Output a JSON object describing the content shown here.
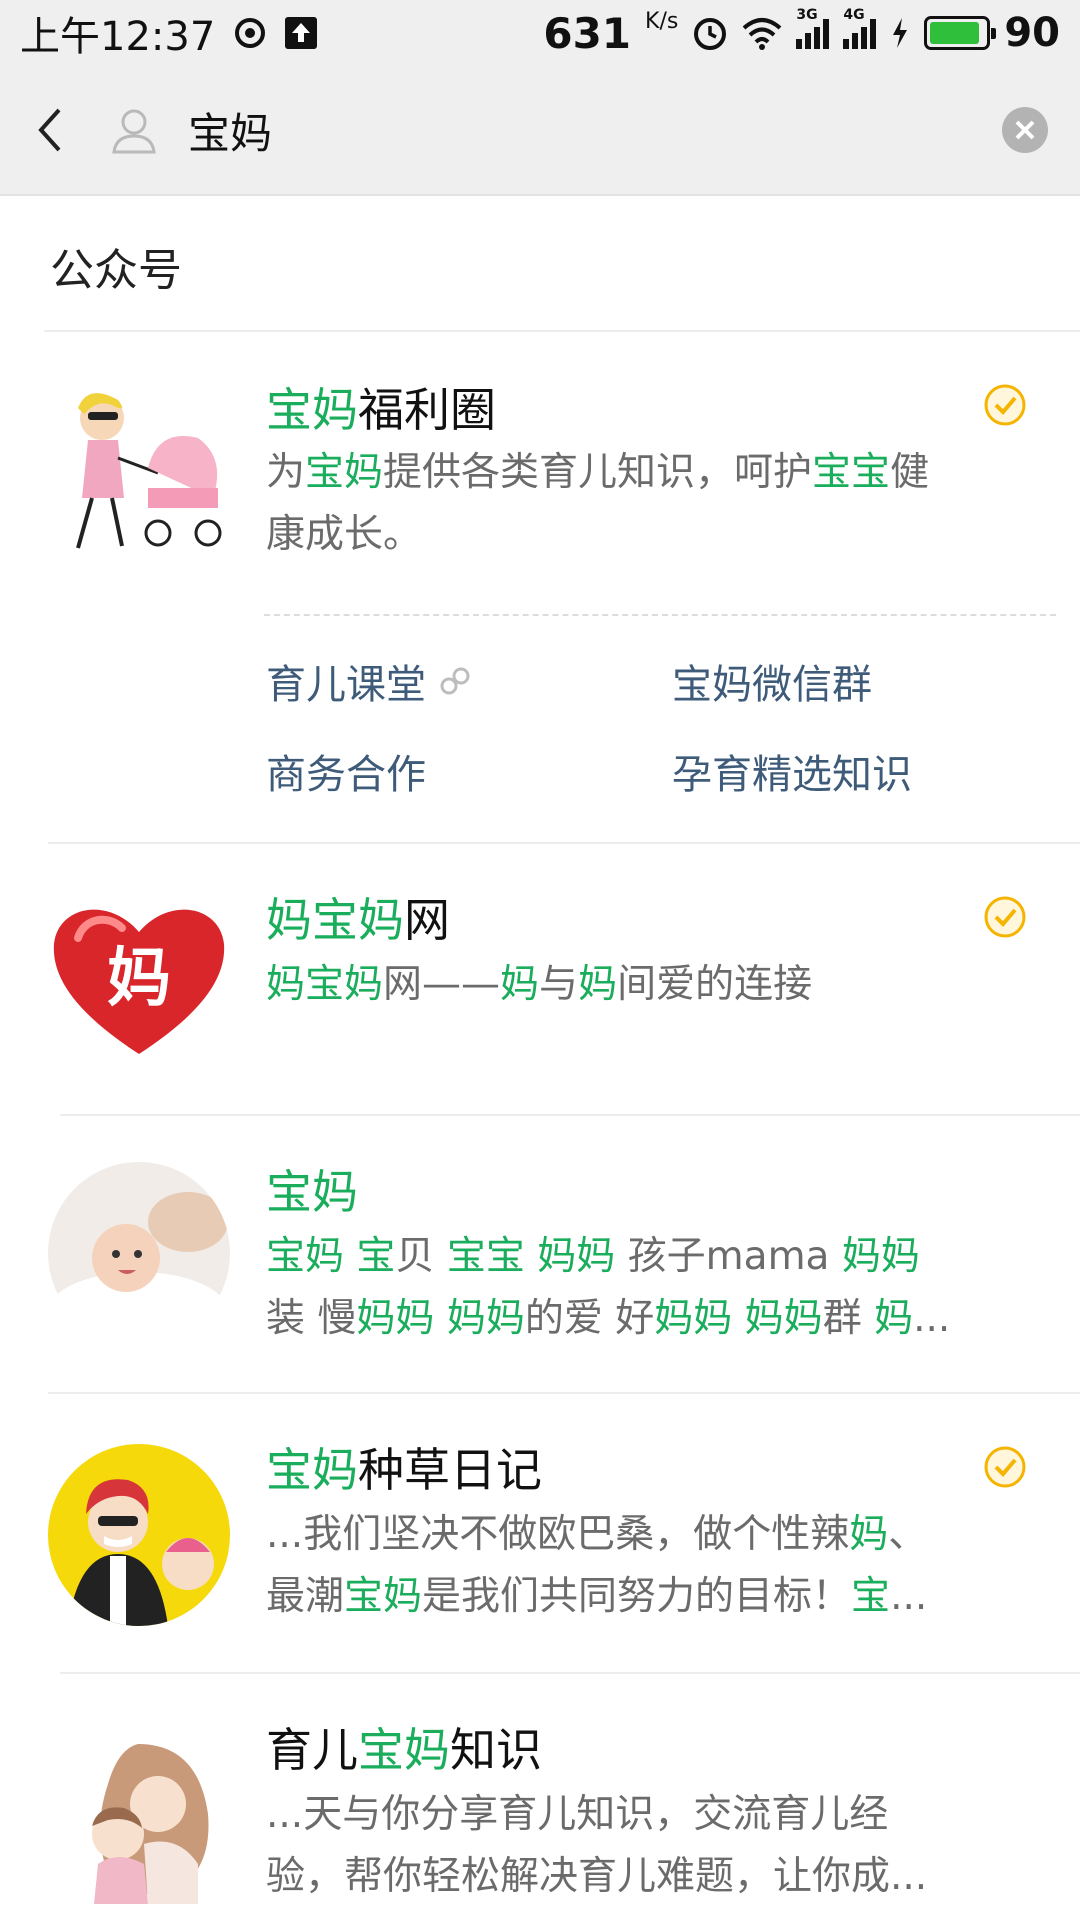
{
  "status_bar": {
    "time": "上午12:37",
    "net_speed": "631",
    "net_unit": "K/s",
    "sig1_label": "3G",
    "sig2_label": "4G",
    "battery": "90"
  },
  "search": {
    "query": "宝妈"
  },
  "section": {
    "title": "公众号"
  },
  "results": [
    {
      "name_parts": [
        "宝妈",
        "福利圈"
      ],
      "desc_line1": [
        "为",
        "宝妈",
        "提供各类育儿知识，呵护",
        "宝宝",
        "健"
      ],
      "desc_line2": "康成长。",
      "verified": true,
      "menu": [
        "育儿课堂",
        "宝妈微信群",
        "商务合作",
        "孕育精选知识"
      ]
    },
    {
      "name_parts": [
        "妈宝妈",
        "网"
      ],
      "desc_line1": [
        "妈宝妈",
        "网——",
        "妈",
        "与",
        "妈",
        "间爱的连接"
      ],
      "verified": true
    },
    {
      "name_parts": [
        "宝妈"
      ],
      "desc_line1": [
        "宝妈",
        " ",
        "宝",
        "贝 ",
        "宝宝",
        " ",
        "妈妈",
        " 孩子mama ",
        "妈妈"
      ],
      "desc_line2": [
        "装 慢",
        "妈妈",
        " ",
        "妈妈",
        "的爱 好",
        "妈妈",
        " ",
        "妈妈",
        "群 ",
        "妈",
        "..."
      ],
      "verified": false
    },
    {
      "name_parts": [
        "宝妈",
        "种草日记"
      ],
      "desc_line1": [
        "...我们坚决不做欧巴桑，做个性辣",
        "妈",
        "、"
      ],
      "desc_line2": [
        "最潮",
        "宝妈",
        "是我们共同努力的目标！",
        "宝",
        "..."
      ],
      "verified": true
    },
    {
      "name_parts": [
        "育儿",
        "宝妈",
        "知识"
      ],
      "desc_line1": "...天与你分享育儿知识，交流育儿经",
      "desc_line2": "验，帮你轻松解决育儿难题，让你成...",
      "verified": false
    }
  ],
  "colors": {
    "highlight": "#1aad5b",
    "link": "#3f5b7a",
    "verified_badge": "#f5b400"
  }
}
